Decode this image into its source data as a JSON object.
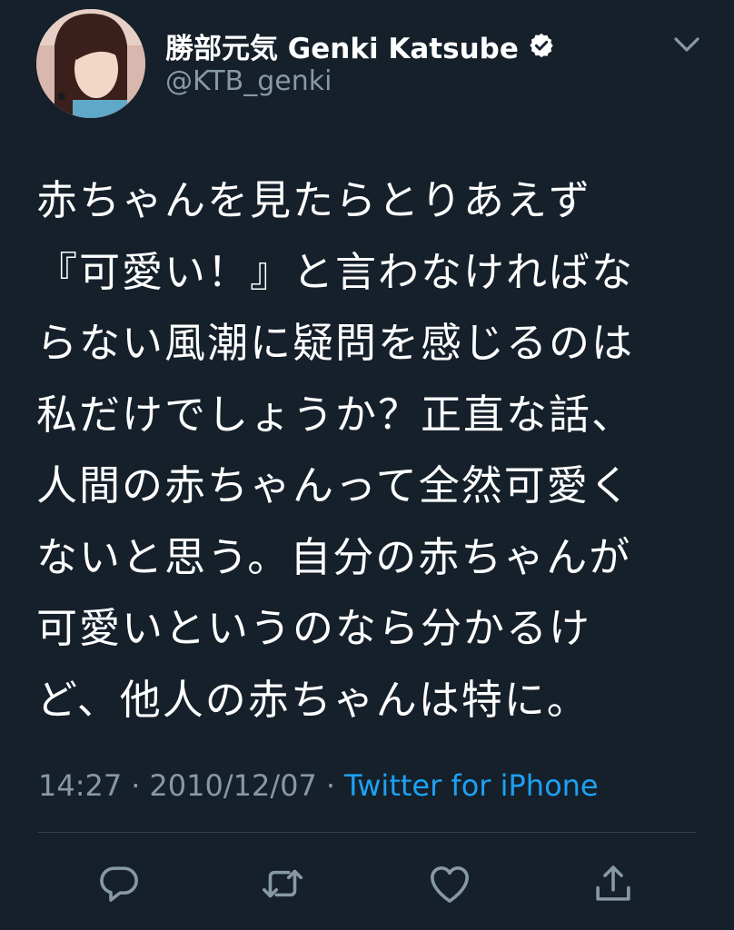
{
  "user": {
    "display_name": "勝部元気 Genki Katsube",
    "handle": "@KTB_genki",
    "avatar_icon": "avatar",
    "verified_icon": "verified-badge-icon"
  },
  "tweet": {
    "lines": [
      "赤ちゃんを見たらとりあえず",
      "『可愛い！』と言わなければな",
      "らない風潮に疑問を感じるのは",
      "私だけでしょうか？正直な話、",
      "人間の赤ちゃんって全然可愛く",
      "ないと思う。自分の赤ちゃんが",
      "可愛いというのなら分かるけ",
      "ど、他人の赤ちゃんは特に。"
    ]
  },
  "meta": {
    "time": "14:27",
    "separator": "·",
    "date": "2010/12/07",
    "source": "Twitter for iPhone"
  },
  "actions": [
    {
      "name": "reply",
      "icon": "reply-icon"
    },
    {
      "name": "retweet",
      "icon": "retweet-icon"
    },
    {
      "name": "like",
      "icon": "heart-icon"
    },
    {
      "name": "share",
      "icon": "share-icon"
    }
  ],
  "colors": {
    "background": "#15202b",
    "text": "#ffffff",
    "muted": "#8899a6",
    "accent": "#1da1f2",
    "divider": "#38444d"
  }
}
